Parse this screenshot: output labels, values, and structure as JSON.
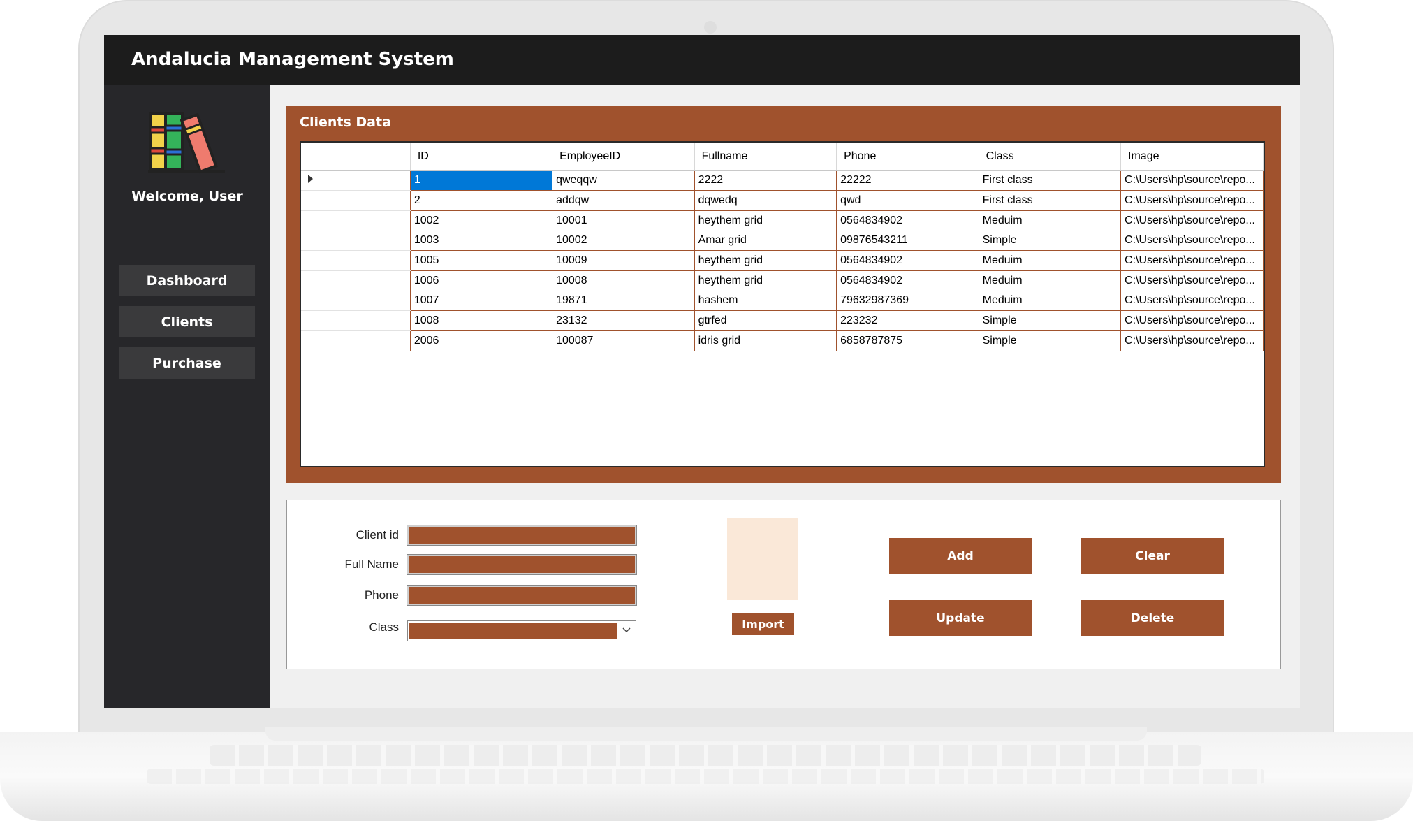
{
  "app": {
    "title": "Andalucia Management System"
  },
  "sidebar": {
    "welcome": "Welcome, User",
    "items": [
      {
        "label": "Dashboard"
      },
      {
        "label": "Clients"
      },
      {
        "label": "Purchase"
      }
    ]
  },
  "clients_panel": {
    "title": "Clients Data",
    "columns": [
      "ID",
      "EmployeeID",
      "Fullname",
      "Phone",
      "Class",
      "Image"
    ],
    "selected_row": 0,
    "rows": [
      [
        "1",
        "qweqqw",
        "2222",
        "22222",
        "First class",
        "C:\\Users\\hp\\source\\repo..."
      ],
      [
        "2",
        "addqw",
        "dqwedq",
        "qwd",
        "First class",
        "C:\\Users\\hp\\source\\repo..."
      ],
      [
        "1002",
        "10001",
        "heythem grid",
        "0564834902",
        "Meduim",
        "C:\\Users\\hp\\source\\repo..."
      ],
      [
        "1003",
        "10002",
        "Amar grid",
        "09876543211",
        "Simple",
        "C:\\Users\\hp\\source\\repo..."
      ],
      [
        "1005",
        "10009",
        "heythem grid",
        "0564834902",
        "Meduim",
        "C:\\Users\\hp\\source\\repo..."
      ],
      [
        "1006",
        "10008",
        "heythem grid",
        "0564834902",
        "Meduim",
        "C:\\Users\\hp\\source\\repo..."
      ],
      [
        "1007",
        "19871",
        "hashem",
        "79632987369",
        "Meduim",
        "C:\\Users\\hp\\source\\repo..."
      ],
      [
        "1008",
        "23132",
        "gtrfed",
        "223232",
        "Simple",
        "C:\\Users\\hp\\source\\repo..."
      ],
      [
        "2006",
        "100087",
        "idris grid",
        "6858787875",
        "Simple",
        "C:\\Users\\hp\\source\\repo..."
      ]
    ]
  },
  "form": {
    "client_id_label": "Client id",
    "full_name_label": "Full Name",
    "phone_label": "Phone",
    "class_label": "Class",
    "client_id_value": "",
    "full_name_value": "",
    "phone_value": "",
    "class_value": "",
    "import_label": "Import",
    "add_label": "Add",
    "clear_label": "Clear",
    "update_label": "Update",
    "delete_label": "Delete"
  },
  "colors": {
    "accent": "#a0522d",
    "titlebar": "#1c1c1c",
    "sidebar": "#27272a",
    "selection": "#0078d7",
    "image_placeholder": "#fae8d8"
  },
  "icons": {
    "logo": "books-icon",
    "row_indicator": "triangle-right-icon",
    "dropdown": "chevron-down-icon"
  }
}
